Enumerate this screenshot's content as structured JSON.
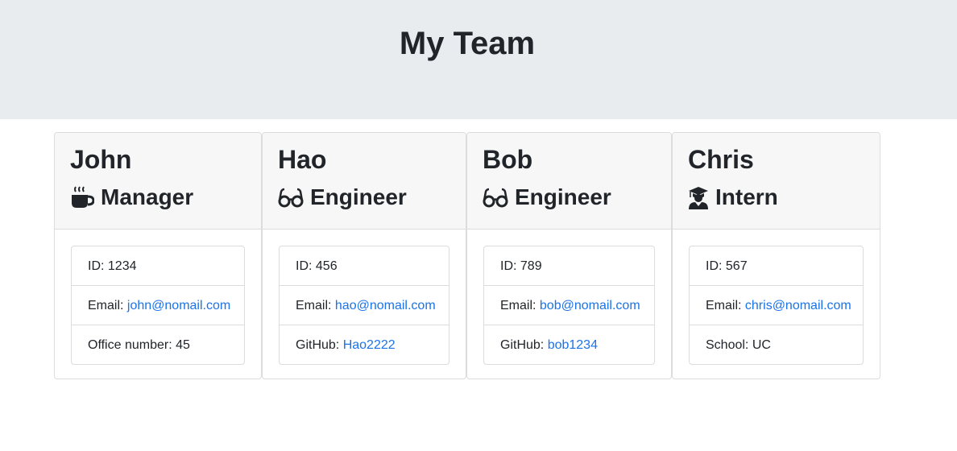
{
  "header": {
    "title": "My Team"
  },
  "team": [
    {
      "name": "John",
      "role": "Manager",
      "icon": "coffee-icon",
      "id_label": "ID: ",
      "id": "1234",
      "email_label": "Email: ",
      "email": "john@nomail.com",
      "extra_label": "Office number: ",
      "extra": "45"
    },
    {
      "name": "Hao",
      "role": "Engineer",
      "icon": "glasses-icon",
      "id_label": "ID: ",
      "id": "456",
      "email_label": "Email: ",
      "email": "hao@nomail.com",
      "extra_label": "GitHub: ",
      "extra": "Hao2222"
    },
    {
      "name": "Bob",
      "role": "Engineer",
      "icon": "glasses-icon",
      "id_label": "ID: ",
      "id": "789",
      "email_label": "Email: ",
      "email": "bob@nomail.com",
      "extra_label": "GitHub: ",
      "extra": "bob1234"
    },
    {
      "name": "Chris",
      "role": "Intern",
      "icon": "graduate-icon",
      "id_label": "ID: ",
      "id": "567",
      "email_label": "Email: ",
      "email": "chris@nomail.com",
      "extra_label": "School: ",
      "extra": "UC"
    }
  ],
  "colors": {
    "link": "#1a73e8",
    "jumbotron": "#e9ecef",
    "card_header": "#f7f7f7"
  }
}
